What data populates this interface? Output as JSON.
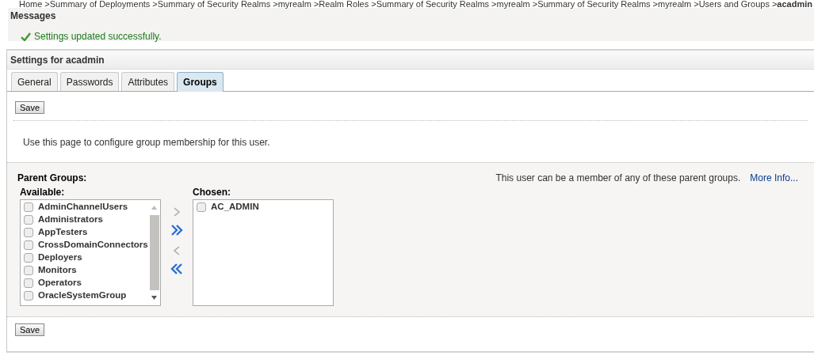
{
  "breadcrumb": {
    "separator": ">",
    "items": [
      "Home",
      "Summary of Deployments",
      "Summary of Security Realms",
      "myrealm",
      "Realm Roles",
      "Summary of Security Realms",
      "myrealm",
      "Summary of Security Realms",
      "myrealm",
      "Users and Groups",
      "acadmin"
    ]
  },
  "messages": {
    "title": "Messages",
    "items": [
      {
        "kind": "success",
        "text": "Settings updated successfully."
      }
    ]
  },
  "settings": {
    "title": "Settings for acadmin",
    "tabs": [
      {
        "label": "General",
        "selected": false
      },
      {
        "label": "Passwords",
        "selected": false
      },
      {
        "label": "Attributes",
        "selected": false
      },
      {
        "label": "Groups",
        "selected": true
      }
    ],
    "save_label": "Save",
    "description": "Use this page to configure group membership for this user.",
    "parent_groups": {
      "label": "Parent Groups:",
      "hint": "This user can be a member of any of these parent groups.",
      "more_info": "More Info...",
      "available": {
        "label": "Available:",
        "items": [
          {
            "label": "AdminChannelUsers",
            "checked": false
          },
          {
            "label": "Administrators",
            "checked": false
          },
          {
            "label": "AppTesters",
            "checked": false
          },
          {
            "label": "CrossDomainConnectors",
            "checked": false
          },
          {
            "label": "Deployers",
            "checked": false
          },
          {
            "label": "Monitors",
            "checked": false
          },
          {
            "label": "Operators",
            "checked": false
          },
          {
            "label": "OracleSystemGroup",
            "checked": false
          }
        ]
      },
      "chosen": {
        "label": "Chosen:",
        "items": [
          {
            "label": "AC_ADMIN",
            "checked": false
          }
        ]
      }
    },
    "bottom_save_label": "Save"
  }
}
